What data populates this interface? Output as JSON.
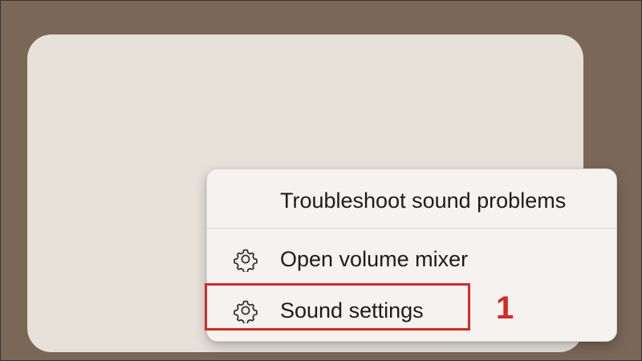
{
  "context_menu": {
    "items": [
      {
        "label": "Troubleshoot sound problems",
        "icon": null
      },
      {
        "label": "Open volume mixer",
        "icon": "gear-icon"
      },
      {
        "label": "Sound settings",
        "icon": "gear-icon"
      }
    ]
  },
  "annotation": {
    "step_number": "1",
    "color": "#d42a2a"
  },
  "colors": {
    "desktop_background": "#7a6758",
    "flyout_background": "#e7e1da",
    "menu_background": "#f5f2ef"
  }
}
